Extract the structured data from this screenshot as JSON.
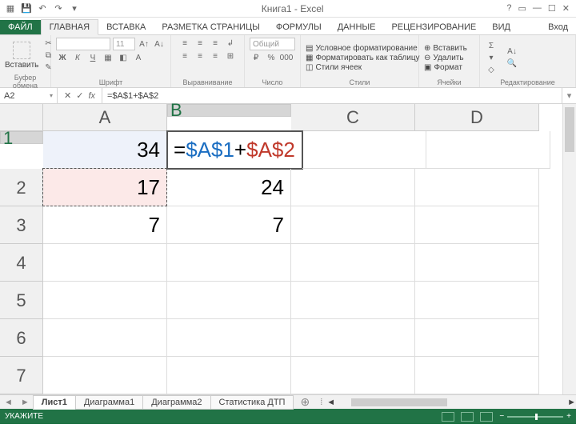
{
  "app": {
    "title": "Книга1 - Excel"
  },
  "tabs": {
    "file": "ФАЙЛ",
    "items": [
      "ГЛАВНАЯ",
      "ВСТАВКА",
      "РАЗМЕТКА СТРАНИЦЫ",
      "ФОРМУЛЫ",
      "ДАННЫЕ",
      "РЕЦЕНЗИРОВАНИЕ",
      "ВИД"
    ],
    "active": "ГЛАВНАЯ",
    "signin": "Вход"
  },
  "ribbon": {
    "clipboard": {
      "paste": "Вставить",
      "label": "Буфер обмена"
    },
    "font": {
      "name": "",
      "size": "11",
      "label": "Шрифт"
    },
    "align": {
      "label": "Выравнивание"
    },
    "number": {
      "format": "Общий",
      "label": "Число"
    },
    "styles": {
      "cond": "Условное форматирование",
      "table": "Форматировать как таблицу",
      "cell": "Стили ячеек",
      "label": "Стили"
    },
    "cells": {
      "insert": "Вставить",
      "delete": "Удалить",
      "format": "Формат",
      "label": "Ячейки"
    },
    "editing": {
      "label": "Редактирование"
    }
  },
  "formula_bar": {
    "name_box": "A2",
    "cancel": "✕",
    "enter": "✓",
    "fx": "fx",
    "formula": "=$A$1+$A$2"
  },
  "grid": {
    "columns": [
      "A",
      "B",
      "C",
      "D"
    ],
    "rows": [
      "1",
      "2",
      "3",
      "4",
      "5",
      "6",
      "7"
    ],
    "cells": {
      "A1": "34",
      "A2": "17",
      "A3": "7",
      "B1_tokens": [
        "=",
        "$A$1",
        "+",
        "$A$2"
      ],
      "B2": "24",
      "B3": "7"
    },
    "active_col": "B",
    "active_row": "1",
    "marquee_cell": "A2"
  },
  "sheets": {
    "items": [
      "Лист1",
      "Диаграмма1",
      "Диаграмма2",
      "Статистика ДТП"
    ],
    "active": "Лист1"
  },
  "status": {
    "mode": "УКАЖИТЕ",
    "zoom": ""
  }
}
